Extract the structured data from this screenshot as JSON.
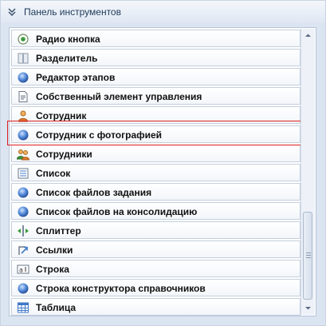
{
  "panel": {
    "title": "Панель инструментов",
    "items": [
      {
        "label": "Радио кнопка",
        "icon": "radio-button-icon"
      },
      {
        "label": "Разделитель",
        "icon": "separator-icon"
      },
      {
        "label": "Редактор этапов",
        "icon": "blue-sphere-icon"
      },
      {
        "label": "Собственный элемент управления",
        "icon": "document-icon"
      },
      {
        "label": "Сотрудник",
        "icon": "person-icon"
      },
      {
        "label": "Сотрудник с фотографией",
        "icon": "blue-sphere-icon"
      },
      {
        "label": "Сотрудники",
        "icon": "people-icon"
      },
      {
        "label": "Список",
        "icon": "list-icon"
      },
      {
        "label": "Список файлов задания",
        "icon": "blue-sphere-icon"
      },
      {
        "label": "Список файлов на консолидацию",
        "icon": "blue-sphere-icon"
      },
      {
        "label": "Сплиттер",
        "icon": "splitter-icon"
      },
      {
        "label": "Ссылки",
        "icon": "link-icon"
      },
      {
        "label": "Строка",
        "icon": "text-field-icon"
      },
      {
        "label": "Строка конструктора справочников",
        "icon": "blue-sphere-icon"
      },
      {
        "label": "Таблица",
        "icon": "table-icon"
      }
    ],
    "highlighted_item": "Сотрудник с фотографией"
  },
  "colors": {
    "header_text": "#1e3a5a",
    "highlight_border": "#e02020",
    "sphere": "#3f78c7"
  }
}
